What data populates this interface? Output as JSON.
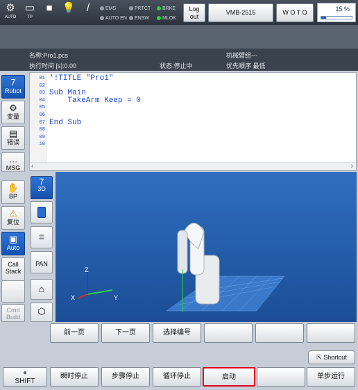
{
  "topbar": {
    "auto": {
      "label": "AUTO",
      "icon": "robot-arm-icon"
    },
    "tp": {
      "label": "TP",
      "icon": "teach-pendant-icon"
    },
    "stop": {
      "icon": "stop-square-icon"
    },
    "light": {
      "icon": "light-bulb-icon"
    },
    "wrench": {
      "icon": "wrench-icon"
    },
    "indicators": {
      "ems": "EMS",
      "auto_en": "AUTO EN",
      "prtct": "PRTCT",
      "ensw": "ENSW",
      "brake": "BRKE",
      "mlok": "MLOK"
    },
    "logout_line1": "Log",
    "logout_line2": "out",
    "robot_model": "VMB-2515",
    "woto": "W O T O",
    "speed": "15 %",
    "speed_fraction": 0.15,
    "active_color": "#29d33a"
  },
  "info": {
    "name": "名称:Pro1.pcs",
    "exec_time": "执行时间 [s]:0.00",
    "status": "状态:停止中",
    "arm": "机械臂组---",
    "priority": "优先顺序 最低"
  },
  "sidebar": {
    "robot": "Robot",
    "variable": "变量",
    "error": "错误",
    "msg": "MSG",
    "bp": "BP",
    "reset": "复位",
    "auto": "Auto",
    "callstack_line1": "Call",
    "callstack_line2": "Stack",
    "cmd_line1": "Cmd",
    "cmd_line2": "Build"
  },
  "editor": {
    "lines": [
      {
        "no": "01",
        "code": "'!TITLE \"Pro1\""
      },
      {
        "no": "02",
        "code": ""
      },
      {
        "no": "03",
        "code": "Sub Main"
      },
      {
        "no": "04",
        "code": "    TakeArm Keep = 0"
      },
      {
        "no": "05",
        "code": ""
      },
      {
        "no": "06",
        "code": ""
      },
      {
        "no": "07",
        "code": "End Sub"
      },
      {
        "no": "08",
        "code": ""
      },
      {
        "no": "09",
        "code": ""
      },
      {
        "no": "10",
        "code": ""
      }
    ]
  },
  "viewtools": {
    "3d": "3D",
    "pan": "PAN"
  },
  "axes": {
    "x": "X",
    "y": "Y",
    "z": "Z"
  },
  "nav": {
    "prev": "前一页",
    "next": "下一页",
    "select": "选择编号"
  },
  "shortcut": "Shortcut",
  "bottom": {
    "shift": "SHIFT",
    "instant_stop": "瞬时停止",
    "step_stop": "步骤停止",
    "cycle_stop": "循环停止",
    "start": "启动",
    "single_step": "单步运行",
    "highlight_color": "#e0001b"
  }
}
